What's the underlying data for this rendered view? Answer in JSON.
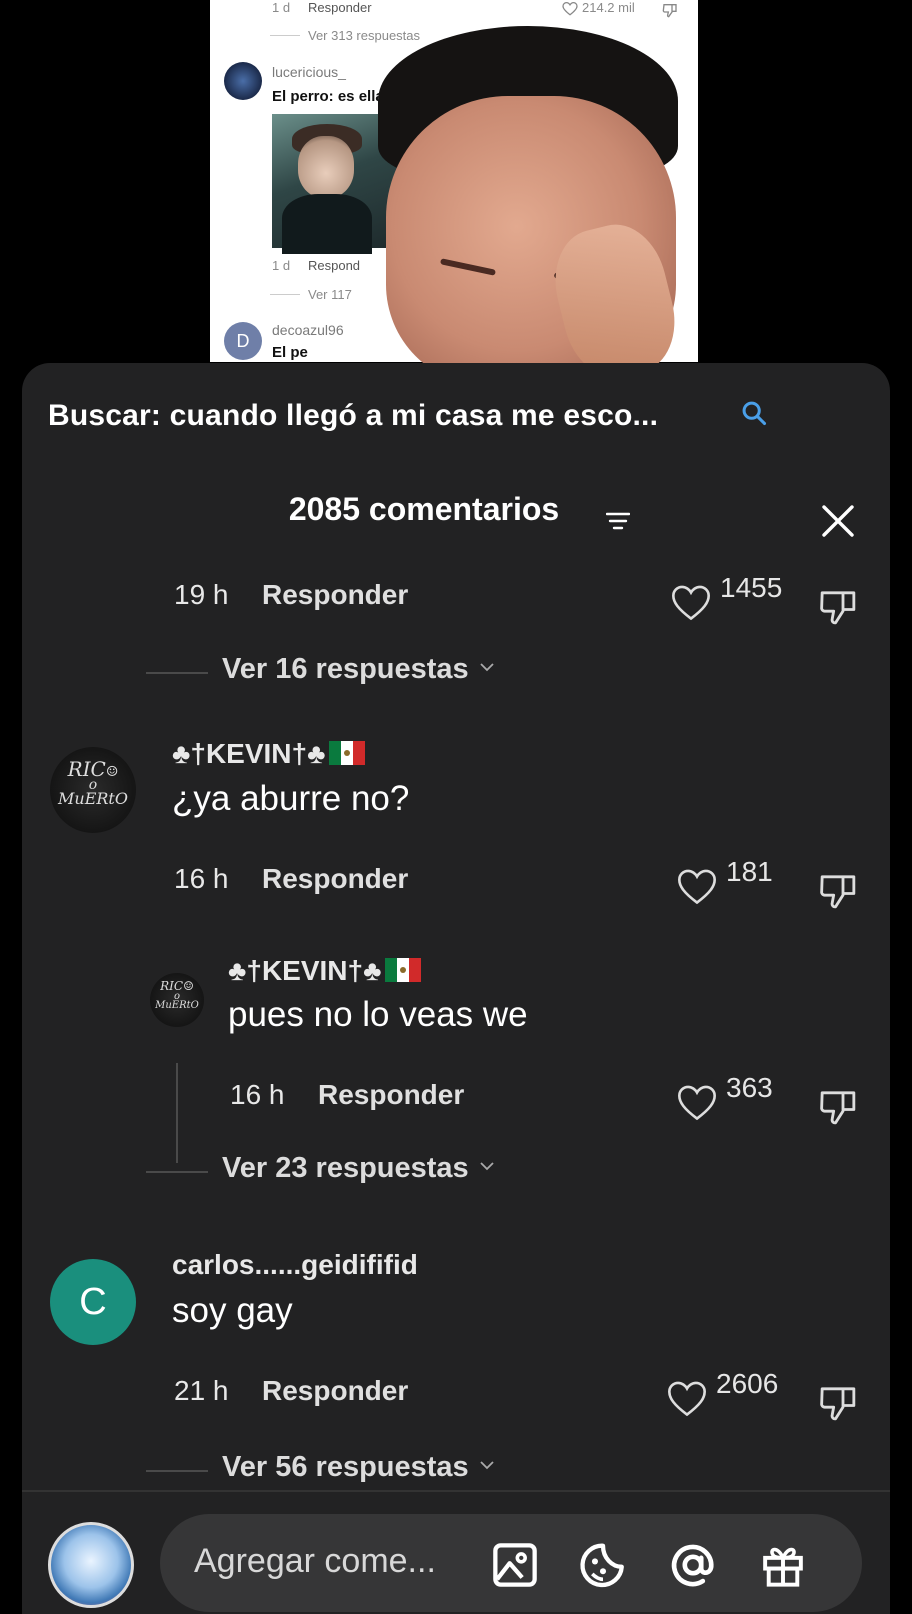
{
  "video_screenshot": {
    "top_row": {
      "time": "1 d",
      "reply": "Responder",
      "likes": "214.2 mil"
    },
    "top_more": "Ver 313 respuestas",
    "comment": {
      "username": "lucericious_",
      "text": "El perro: es ella"
    },
    "mid_row": {
      "time": "1 d",
      "reply": "Respond"
    },
    "mid_more": "Ver 117",
    "next_user": {
      "avatar_letter": "D",
      "username": "decoazul96",
      "text": "El pe"
    }
  },
  "panel": {
    "search_text": "Buscar: cuando llegó a mi casa me esco...",
    "comment_count": "2085 comentarios"
  },
  "comments": [
    {
      "time": "19 h",
      "reply": "Responder",
      "likes": "1455",
      "more": "Ver 16 respuestas"
    },
    {
      "username": "♣†KEVIN†♣",
      "avatar": "RICO O MUERTO",
      "text": "¿ya aburre no?",
      "time": "16 h",
      "reply": "Responder",
      "likes": "181",
      "reply_item": {
        "username": "♣†KEVIN†♣",
        "text": "pues no lo veas we",
        "time": "16 h",
        "reply": "Responder",
        "likes": "363"
      },
      "more": "Ver 23 respuestas"
    },
    {
      "username": "carlos......geidififid",
      "avatar_letter": "C",
      "text": "soy gay",
      "time": "21 h",
      "reply": "Responder",
      "likes": "2606",
      "more": "Ver 56 respuestas"
    }
  ],
  "input": {
    "placeholder": "Agregar come..."
  },
  "colors": {
    "panel_bg": "#222223",
    "input_bg": "#363637",
    "avatar_c": "#1a8f7d",
    "search_icon": "#4a9fe8"
  }
}
